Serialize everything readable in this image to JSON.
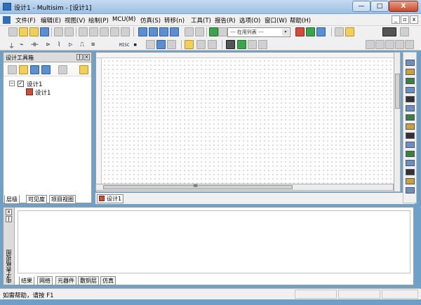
{
  "window": {
    "title": "设计1 - Multisim - [设计1]",
    "min_label": "—",
    "max_label": "□",
    "close_label": "X"
  },
  "menu": {
    "items": [
      "文件(F)",
      "编辑(E)",
      "视图(V)",
      "绘制(P)",
      "MCU(M)",
      "仿真(S)",
      "转移(n)",
      "工具(T)",
      "报告(R)",
      "选项(O)",
      "窗口(W)",
      "帮助(H)"
    ],
    "mdi_min": "_",
    "mdi_restore": "▫",
    "mdi_close": "x"
  },
  "toolbar": {
    "in_use_list": "--- 在用列表 ---",
    "combo_arrow": "▾",
    "component_symbols": [
      "⏚",
      "⌁",
      "⊣⊢",
      "⊳",
      "⌇",
      "▷",
      "⎍",
      "≋",
      "MISC",
      "▪"
    ]
  },
  "toolbox": {
    "title": "设计工具箱",
    "pin_label": "ǀ",
    "close_label": "x",
    "tree": {
      "expander": "−",
      "root": "设计1",
      "child": "设计1",
      "checkmark": "✓"
    },
    "tabs": [
      "层级",
      "可见度",
      "项目视图"
    ]
  },
  "canvas": {
    "doc_tab": "设计1",
    "scroll_grip": "III"
  },
  "bottom_panel": {
    "side_label": "电子表格视图",
    "close_label": "x",
    "pin_label": "ǀ",
    "tabs": [
      "结果",
      "网络",
      "元器件",
      "敷铜层",
      "仿真"
    ]
  },
  "status": {
    "text": "如需帮助，请按 F1"
  },
  "colors": {
    "title_gradient_top": "#c5dbf1",
    "title_gradient_bottom": "#9dc0e4",
    "close_button": "#c74a2b",
    "desktop": "#6fa0c8"
  }
}
